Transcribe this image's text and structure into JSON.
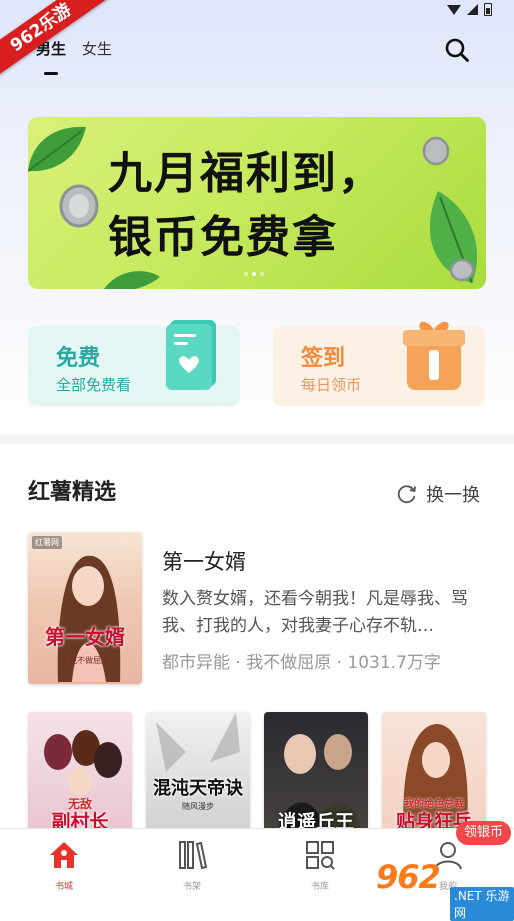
{
  "watermark": {
    "corner_text": "962乐游",
    "bottom_logo": "962",
    "bottom_sub": ".NET 乐游网"
  },
  "tabs": [
    {
      "label": "男生",
      "active": true
    },
    {
      "label": "女生",
      "active": false
    }
  ],
  "banner": {
    "line1": "九月福利到，",
    "line2": "银币免费拿",
    "dots": 3,
    "active_dot": 1
  },
  "quick_cards": {
    "free": {
      "title": "免费",
      "subtitle": "全部免费看"
    },
    "sign": {
      "title": "签到",
      "subtitle": "每日领币"
    }
  },
  "section": {
    "title": "红薯精选",
    "refresh_label": "换一换"
  },
  "featured_book": {
    "title": "第一女婿",
    "description": "数入赘女婿，还看今朝我！凡是辱我、骂我、打我的人，对我妻子心存不轨…",
    "meta": "都市异能 · 我不做屈原 · 1031.7万字",
    "cover_text": "第一女婿",
    "cover_publisher": "红薯网",
    "cover_author": "之我不做屈原"
  },
  "books": [
    {
      "cover_text": "副村长",
      "cover_top": "无敌"
    },
    {
      "cover_text": "混沌天帝诀",
      "cover_author": "随风漫步"
    },
    {
      "cover_text": "逍遥丘王"
    },
    {
      "cover_text": "贴身狂兵",
      "cover_top": "我的绝色总裁"
    }
  ],
  "coin_badge": "领银币",
  "bottom_nav": [
    {
      "label": "书城",
      "icon": "home-icon",
      "active": true
    },
    {
      "label": "书架",
      "icon": "bookshelf-icon",
      "active": false
    },
    {
      "label": "书库",
      "icon": "library-icon",
      "active": false
    },
    {
      "label": "我的",
      "icon": "profile-icon",
      "active": false
    }
  ],
  "colors": {
    "accent": "#e8332b",
    "free_card": "#28a8a0",
    "sign_card": "#f28a3a"
  }
}
